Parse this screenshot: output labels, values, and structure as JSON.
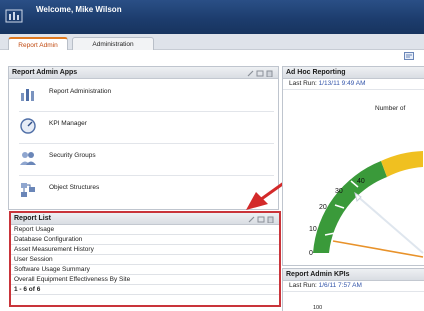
{
  "header": {
    "welcome": "Welcome, Mike Wilson"
  },
  "tabs": [
    {
      "label": "Report Admin",
      "active": true
    },
    {
      "label": "Administration",
      "active": false
    }
  ],
  "apps_panel": {
    "title": "Report Admin Apps",
    "items": [
      {
        "label": "Report Administration",
        "icon": "report-admin-icon"
      },
      {
        "label": "KPI Manager",
        "icon": "kpi-manager-icon"
      },
      {
        "label": "Security Groups",
        "icon": "security-groups-icon"
      },
      {
        "label": "Object Structures",
        "icon": "object-structures-icon"
      }
    ]
  },
  "report_list": {
    "title": "Report List",
    "rows": [
      "Report Usage",
      "Database Configuration",
      "Asset Measurement History",
      "User Session",
      "Software Usage Summary",
      "Overall Equipment Effectiveness By Site"
    ],
    "count": "1 - 6 of 6"
  },
  "adhoc": {
    "title": "Ad Hoc Reporting",
    "last_run_label": "Last Run:",
    "last_run_value": "1/13/11 9:49 AM",
    "gauge_title": "Number of",
    "gauge_ticks": [
      "0",
      "10",
      "20",
      "30",
      "40"
    ]
  },
  "kpis": {
    "title": "Report Admin KPIs",
    "last_run_label": "Last Run:",
    "last_run_value": "1/6/11 7:57 AM",
    "axis_value": "100"
  },
  "colors": {
    "header_bg": "#1d3d6e",
    "active_tab_accent": "#e07a20",
    "highlight_border": "#c9343a",
    "gauge_green": "#3a9a3a",
    "gauge_yellow": "#f0c020",
    "needle_orange": "#e8922a",
    "link_blue": "#3355aa"
  }
}
